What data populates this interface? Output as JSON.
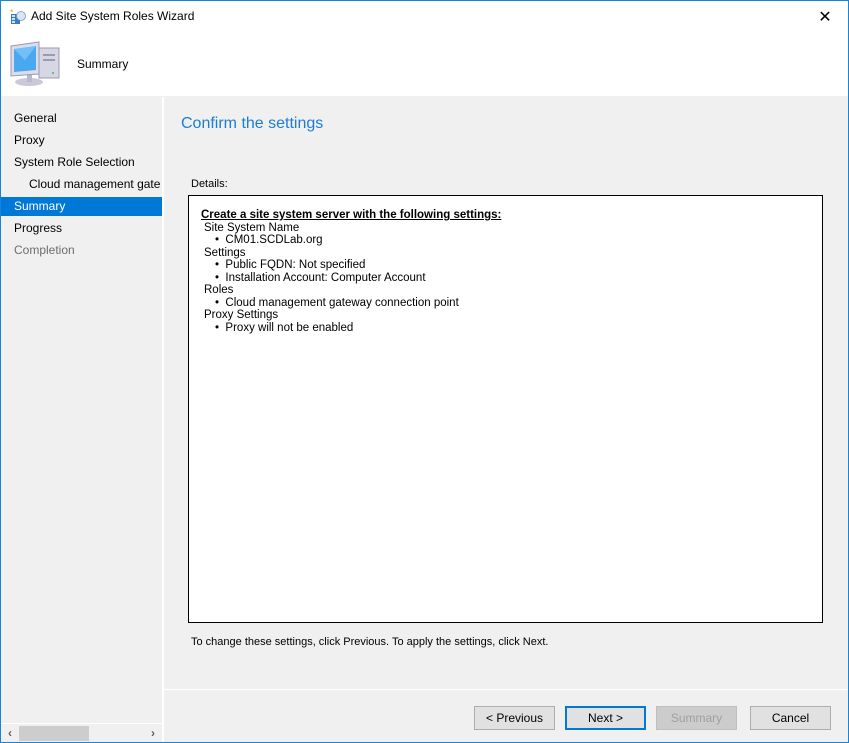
{
  "window": {
    "title": "Add Site System Roles Wizard",
    "close_glyph": "✕"
  },
  "header": {
    "title": "Summary",
    "icon": "computer-icon"
  },
  "sidebar": {
    "items": [
      {
        "label": "General",
        "state": "normal"
      },
      {
        "label": "Proxy",
        "state": "normal"
      },
      {
        "label": "System Role Selection",
        "state": "normal"
      },
      {
        "label": "Cloud management gate",
        "state": "normal",
        "indent": true
      },
      {
        "label": "Summary",
        "state": "selected"
      },
      {
        "label": "Progress",
        "state": "normal"
      },
      {
        "label": "Completion",
        "state": "disabled"
      }
    ],
    "scroll_left": "‹",
    "scroll_right": "›"
  },
  "main": {
    "heading": "Confirm the settings",
    "details_label": "Details:",
    "details": {
      "header": "Create a site system server with the following settings:",
      "sections": [
        {
          "title": "Site System Name",
          "items": [
            "CM01.SCDLab.org"
          ]
        },
        {
          "title": "Settings",
          "items": [
            "Public FQDN: Not specified",
            "Installation Account: Computer Account"
          ]
        },
        {
          "title": "Roles",
          "items": [
            "Cloud management gateway connection point"
          ]
        },
        {
          "title": "Proxy Settings",
          "items": [
            "Proxy will not be enabled"
          ]
        }
      ]
    },
    "hint": "To change these settings, click Previous. To apply the settings, click Next."
  },
  "buttons": {
    "previous": "< Previous",
    "next": "Next >",
    "summary": "Summary",
    "cancel": "Cancel"
  },
  "colors": {
    "accent": "#0078d7",
    "heading": "#1c7dd6",
    "window_border": "#1883d7"
  }
}
